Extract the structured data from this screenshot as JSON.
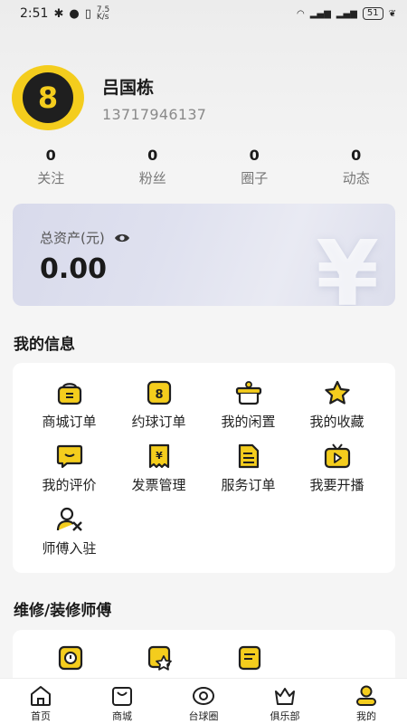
{
  "status_bar": {
    "time": "2:51",
    "net_speed_top": "7.5",
    "net_speed_bottom": "K/s",
    "battery": "51"
  },
  "profile": {
    "avatar_text": "8",
    "name": "吕国栋",
    "phone": "13717946137"
  },
  "stats": [
    {
      "count": "0",
      "label": "关注"
    },
    {
      "count": "0",
      "label": "粉丝"
    },
    {
      "count": "0",
      "label": "圈子"
    },
    {
      "count": "0",
      "label": "动态"
    }
  ],
  "assets": {
    "label": "总资产(元)",
    "value": "0.00",
    "decor": "¥"
  },
  "my_info": {
    "title": "我的信息",
    "items": [
      {
        "label": "商城订单",
        "icon": "basket-icon"
      },
      {
        "label": "约球订单",
        "icon": "ball-8-icon",
        "icon_text": "8"
      },
      {
        "label": "我的闲置",
        "icon": "box-icon"
      },
      {
        "label": "我的收藏",
        "icon": "star-icon"
      },
      {
        "label": "我的评价",
        "icon": "comment-icon"
      },
      {
        "label": "发票管理",
        "icon": "invoice-icon",
        "icon_text": "¥"
      },
      {
        "label": "服务订单",
        "icon": "document-icon"
      },
      {
        "label": "我要开播",
        "icon": "live-tv-icon"
      },
      {
        "label": "师傅入驻",
        "icon": "worker-icon"
      }
    ]
  },
  "repair": {
    "title": "维修/装修师傅"
  },
  "bottom_nav": [
    {
      "label": "首页",
      "icon": "home-icon"
    },
    {
      "label": "商城",
      "icon": "shop-bag-icon"
    },
    {
      "label": "台球圈",
      "icon": "circle-eye-icon"
    },
    {
      "label": "俱乐部",
      "icon": "crown-icon"
    },
    {
      "label": "我的",
      "icon": "profile-icon"
    }
  ],
  "colors": {
    "accent_yellow": "#f4cd1d",
    "dark": "#1f1f1f"
  }
}
